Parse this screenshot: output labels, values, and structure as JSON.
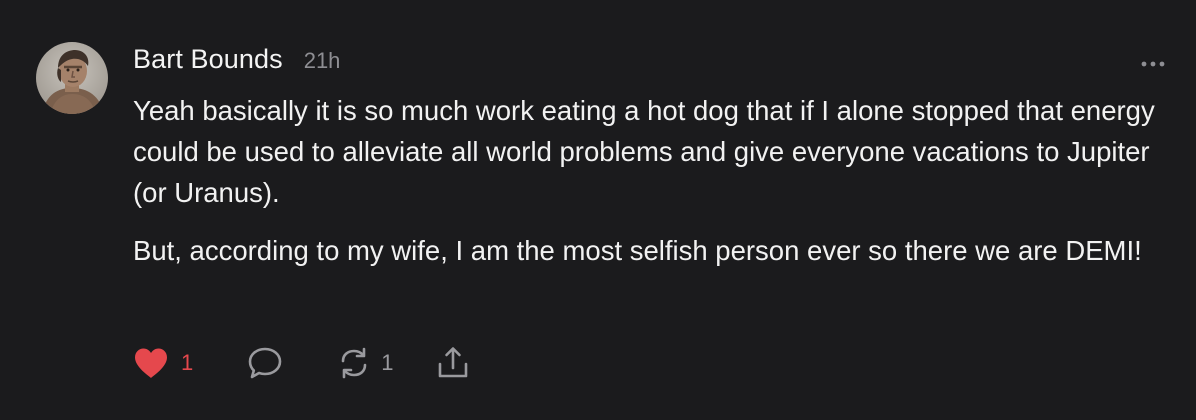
{
  "comment": {
    "author": "Bart Bounds",
    "timestamp": "21h",
    "paragraphs": [
      "Yeah basically it is so much work eating a hot dog that if I alone stopped that energy could be used to alleviate all world problems and give everyone vacations to Jupiter (or Uranus).",
      "But, according to my wife, I am the most selfish person ever so there we are DEMI!"
    ],
    "actions": {
      "like_count": "1",
      "restack_count": "1"
    },
    "icons": [
      "avatar",
      "more-icon",
      "heart-icon",
      "comment-icon",
      "restack-icon",
      "share-icon"
    ]
  },
  "colors": {
    "background": "#1b1b1d",
    "text": "#f2f2f2",
    "muted": "#8e8e93",
    "like": "#e5484d"
  }
}
